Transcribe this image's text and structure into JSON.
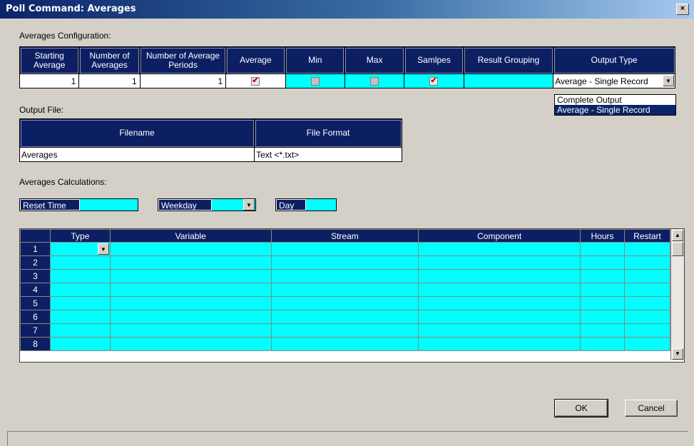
{
  "window": {
    "title": "Poll Command: Averages",
    "close_glyph": "×"
  },
  "config": {
    "label": "Averages Configuration:",
    "headers": {
      "starting_average": "Starting Average",
      "number_of_averages": "Number of Averages",
      "number_of_average_periods": "Number of Average Periods",
      "average": "Average",
      "min": "Min",
      "max": "Max",
      "samples": "Samlpes",
      "result_grouping": "Result Grouping",
      "output_type": "Output Type"
    },
    "values": {
      "starting_average": "1",
      "number_of_averages": "1",
      "number_of_average_periods": "1",
      "average_checked": true,
      "min_checked": false,
      "max_checked": false,
      "samples_checked": true,
      "result_grouping": "",
      "output_type": "Average - Single Record"
    },
    "output_type_options": [
      "Complete Output",
      "Average - Single Record"
    ]
  },
  "output_file": {
    "label": "Output File:",
    "headers": {
      "filename": "Filename",
      "file_format": "File Format"
    },
    "filename": "Averages",
    "file_format": "Text <*.txt>"
  },
  "calculations": {
    "label": "Averages Calculations:",
    "reset_time_label": "Reset Time",
    "weekday_label": "Weekday",
    "day_label": "Day"
  },
  "grid": {
    "headers": {
      "type": "Type",
      "variable": "Variable",
      "stream": "Stream",
      "component": "Component",
      "hours": "Hours",
      "restart": "Restart"
    },
    "rows": [
      "1",
      "2",
      "3",
      "4",
      "5",
      "6",
      "7",
      "8"
    ]
  },
  "buttons": {
    "ok": "OK",
    "cancel": "Cancel"
  },
  "colors": {
    "header_bg": "#0c1f63",
    "cell_cyan": "#00ffff",
    "dialog_bg": "#d4d0c8",
    "title_start": "#0a246a"
  }
}
